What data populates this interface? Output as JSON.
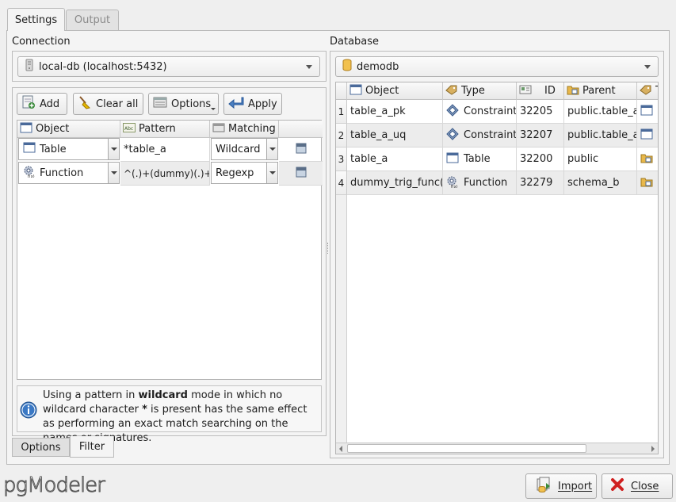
{
  "tabs": {
    "settings": "Settings",
    "output": "Output"
  },
  "connection": {
    "label": "Connection",
    "selected": "local-db (localhost:5432)"
  },
  "database": {
    "label": "Database",
    "selected": "demodb"
  },
  "toolbar": {
    "add": "Add",
    "clear_all": "Clear all",
    "options": "Options",
    "apply": "Apply"
  },
  "filter_table": {
    "headers": {
      "object": "Object",
      "pattern": "Pattern",
      "matching": "Matching"
    },
    "rows": [
      {
        "object": "Table",
        "pattern": "*table_a",
        "matching": "Wildcard"
      },
      {
        "object": "Function",
        "pattern": "^(.)+(dummy)(.)+",
        "matching": "Regexp"
      }
    ]
  },
  "info": {
    "before_bold1": "Using a pattern in ",
    "bold1": "wildcard",
    "after_bold1": " mode in which no wildcard character ",
    "bold2": "*",
    "after_bold2": " is present has the same effect as performing an exact match searching on the names or signatures."
  },
  "bottom_tabs": {
    "options": "Options",
    "filter": "Filter"
  },
  "results_table": {
    "headers": {
      "object": "Object",
      "type": "Type",
      "id": "ID",
      "parent": "Parent",
      "type2": "T"
    },
    "rows": [
      {
        "num": "1",
        "object": "table_a_pk",
        "type": "Constraint",
        "id": "32205",
        "parent": "public.table_a"
      },
      {
        "num": "2",
        "object": "table_a_uq",
        "type": "Constraint",
        "id": "32207",
        "parent": "public.table_a"
      },
      {
        "num": "3",
        "object": "table_a",
        "type": "Table",
        "id": "32200",
        "parent": "public"
      },
      {
        "num": "4",
        "object": "dummy_trig_func()",
        "type": "Function",
        "id": "32279",
        "parent": "schema_b"
      }
    ]
  },
  "footer": {
    "logo": "pgModeler",
    "import": "Import",
    "close": "Close"
  }
}
